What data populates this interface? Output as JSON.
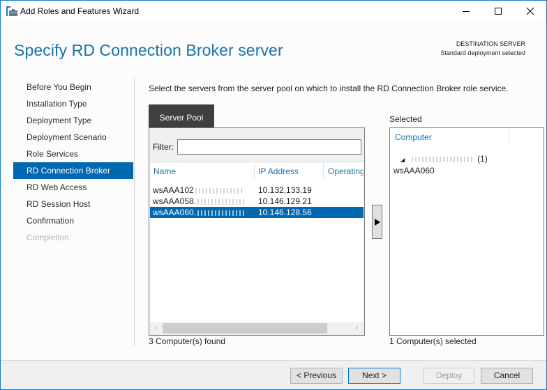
{
  "window": {
    "title": "Add Roles and Features Wizard",
    "icon": "server-manager-icon",
    "controls": {
      "minimize": "minimize-icon",
      "maximize": "maximize-icon",
      "close": "close-icon"
    }
  },
  "header": {
    "title": "Specify RD Connection Broker server",
    "destination_label": "DESTINATION SERVER",
    "destination_value": "Standard deployment selected"
  },
  "nav": {
    "items": [
      {
        "label": "Before You Begin",
        "state": "normal"
      },
      {
        "label": "Installation Type",
        "state": "normal"
      },
      {
        "label": "Deployment Type",
        "state": "normal"
      },
      {
        "label": "Deployment Scenario",
        "state": "normal"
      },
      {
        "label": "Role Services",
        "state": "normal"
      },
      {
        "label": "RD Connection Broker",
        "state": "active"
      },
      {
        "label": "RD Web Access",
        "state": "normal"
      },
      {
        "label": "RD Session Host",
        "state": "normal"
      },
      {
        "label": "Confirmation",
        "state": "normal"
      },
      {
        "label": "Completion",
        "state": "disabled"
      }
    ]
  },
  "main": {
    "instruction": "Select the servers from the server pool on which to install the RD Connection Broker role service.",
    "tab_label": "Server Pool",
    "filter": {
      "label": "Filter:",
      "value": "",
      "placeholder": ""
    },
    "columns": [
      "Name",
      "IP Address",
      "Operating"
    ],
    "rows": [
      {
        "name": "wsAAA102",
        "name_suffix_redacted": true,
        "ip": "10.132.133.19",
        "selected": false
      },
      {
        "name": "wsAAA058.",
        "name_suffix_redacted": true,
        "ip": "10.146.129.21",
        "selected": false
      },
      {
        "name": "wsAAA060.",
        "name_suffix_redacted": true,
        "ip": "10.146.128.56",
        "selected": true
      }
    ],
    "found_text": "3 Computer(s) found",
    "scroll_left": "‹",
    "scroll_right": "›",
    "add_button_icon": "▶"
  },
  "selected": {
    "label": "Selected",
    "column": "Computer",
    "group_toggle": "◢",
    "group_count": "(1)",
    "items": [
      "wsAAA060"
    ],
    "count_text": "1 Computer(s) selected"
  },
  "footer": {
    "previous": "< Previous",
    "next": "Next >",
    "deploy": "Deploy",
    "cancel": "Cancel"
  }
}
